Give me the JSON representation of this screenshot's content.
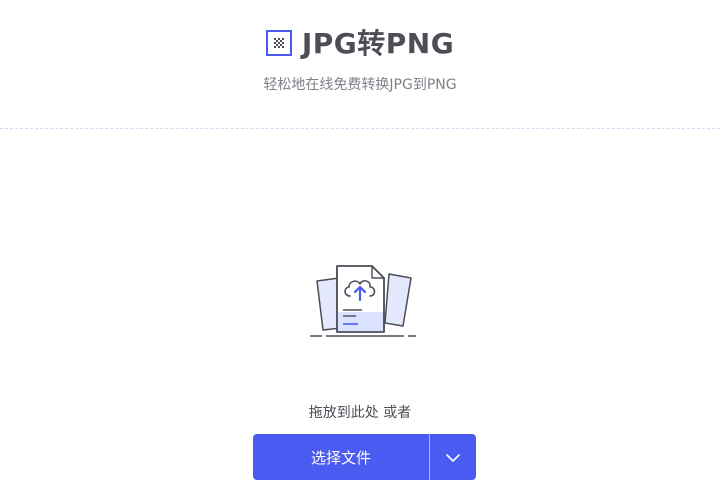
{
  "header": {
    "title": "JPG转PNG",
    "subtitle": "轻松地在线免费转换JPG到PNG",
    "logo_icon": "checker-image-icon"
  },
  "upload": {
    "illustration_icon": "cloud-upload-document-icon",
    "drop_text": "拖放到此处 或者",
    "choose_file_label": "选择文件",
    "dropdown_icon": "chevron-down-icon"
  },
  "colors": {
    "accent": "#4a5bf2",
    "title_text": "#4d4d57",
    "subtitle_text": "#808089",
    "divider": "#d6d9f3"
  }
}
